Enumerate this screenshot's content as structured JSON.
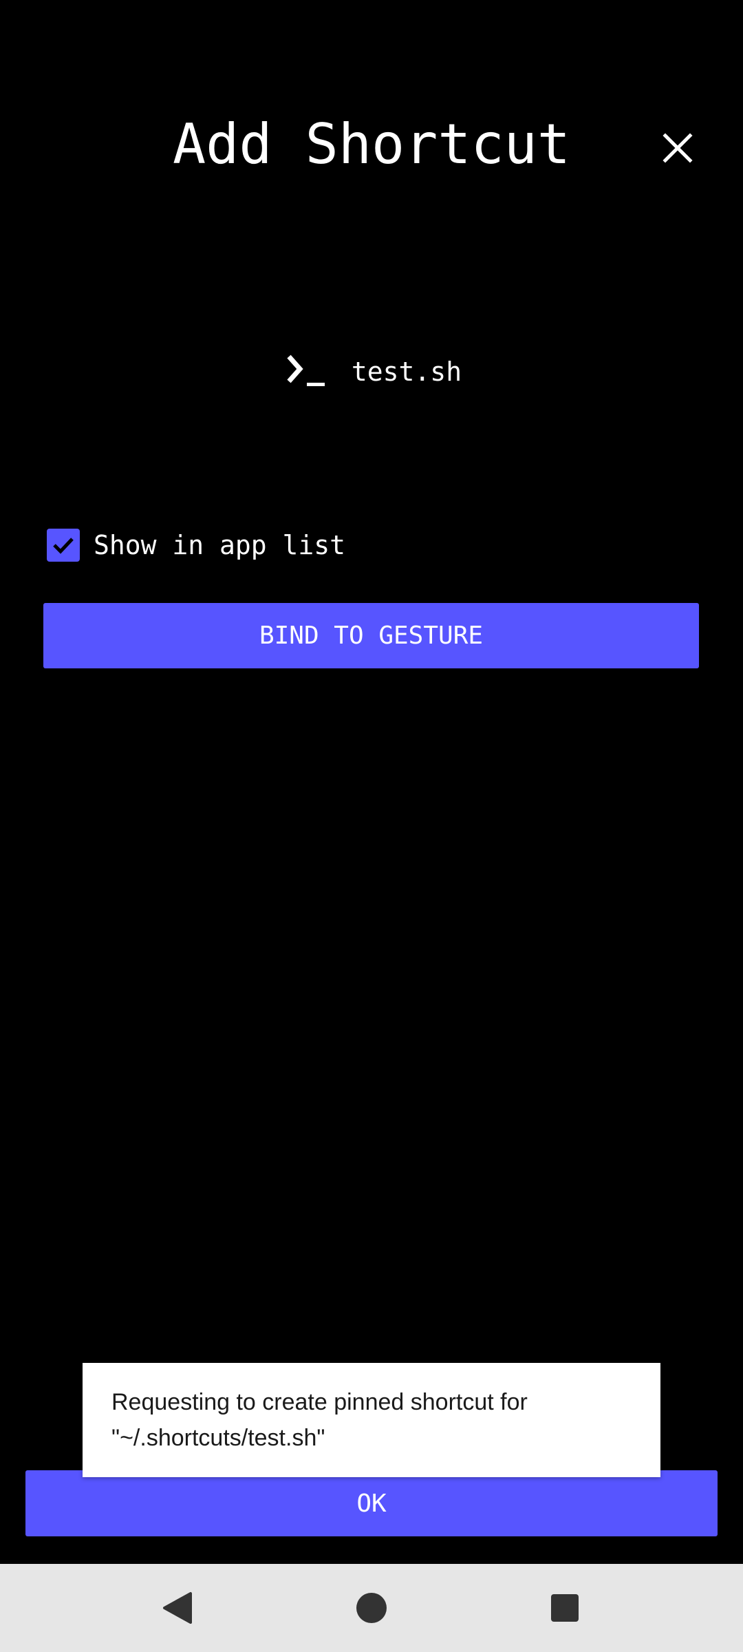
{
  "dialog": {
    "title": "Add Shortcut",
    "close_icon": "close-icon"
  },
  "shortcut": {
    "icon": "terminal-icon",
    "name": "test.sh"
  },
  "options": {
    "show_in_app_list_label": "Show in app list",
    "show_in_app_list_checked": true
  },
  "buttons": {
    "bind_label": "BIND TO GESTURE",
    "ok_label": "OK"
  },
  "toast": {
    "message": "Requesting to create pinned shortcut for\n\"~/.shortcuts/test.sh\""
  },
  "navigation": {
    "back_icon": "back-triangle-icon",
    "home_icon": "home-circle-icon",
    "recents_icon": "recents-square-icon"
  },
  "colors": {
    "accent": "#5755ff",
    "background": "#000000",
    "nav_bar": "#e6e6e6"
  }
}
